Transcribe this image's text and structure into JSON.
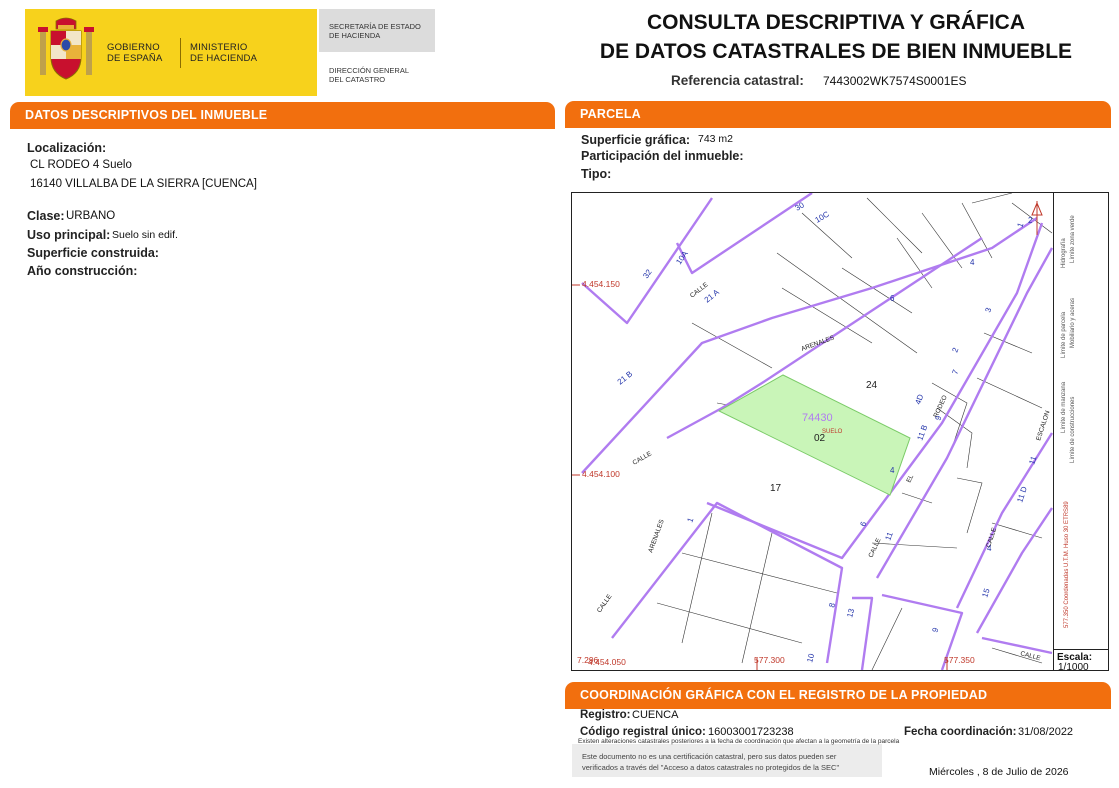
{
  "header": {
    "gobierno_line1": "GOBIERNO",
    "gobierno_line2": "DE ESPAÑA",
    "ministerio_line1": "MINISTERIO",
    "ministerio_line2": "DE HACIENDA",
    "secretaria_line1": "SECRETARÍA DE ESTADO",
    "secretaria_line2": "DE HACIENDA",
    "direccion_line1": "DIRECCIÓN GENERAL",
    "direccion_line2": "DEL CATASTRO",
    "title_line1": "CONSULTA DESCRIPTIVA Y GRÁFICA",
    "title_line2": "DE DATOS CATASTRALES DE BIEN INMUEBLE",
    "ref_label": "Referencia catastral:",
    "ref_value": "7443002WK7574S0001ES",
    "colors": {
      "yellow": "#f7d21c",
      "orange": "#f26f0e",
      "shield_red": "#c8102e"
    },
    "logo_icon": "coat-of-arms-icon"
  },
  "descriptivos": {
    "title": "DATOS DESCRIPTIVOS DEL INMUEBLE",
    "localizacion_label": "Localización:",
    "localizacion_line1": "CL RODEO 4 Suelo",
    "localizacion_line2": "16140 VILLALBA DE LA SIERRA [CUENCA]",
    "clase_label": "Clase:",
    "clase_value": "URBANO",
    "uso_label": "Uso principal:",
    "uso_value": "Suelo sin edif.",
    "superficie_label": "Superficie construida:",
    "anio_label": "Año construcción:"
  },
  "parcela": {
    "title": "PARCELA",
    "superficie_label": "Superficie gráfica:",
    "superficie_value": "743 m2",
    "participacion_label": "Participación del inmueble:",
    "tipo_label": "Tipo:"
  },
  "map": {
    "coord_y1": "4.454.150",
    "coord_y2": "4.454.100",
    "coord_y3": "4.454.050",
    "coord_x0": "7.296",
    "coord_x1": "577.300",
    "coord_x2": "577.350",
    "parcel_ref": "74430",
    "parcel_use": "SUELO",
    "parcel_num": "02",
    "num_24": "24",
    "num_17": "17",
    "street_calle": "CALLE",
    "street_arenales": "ARENALES",
    "street_rodeo": "RODEO",
    "street_el": "EL",
    "street_escalon": "ESCALON",
    "house_numbers": [
      "32",
      "30",
      "10C",
      "10A",
      "21 A",
      "21 B",
      "6",
      "4",
      "4D",
      "2",
      "3",
      "1",
      "9",
      "11 B",
      "7",
      "4",
      "6",
      "11",
      "1",
      "8",
      "13",
      "10",
      "15",
      "11 D",
      "4",
      "9",
      "11",
      "2"
    ],
    "legend": {
      "limite_manzana": "Límite de manzana",
      "limite_parcela": "Límite de parcela",
      "limite_construcciones": "Límite de construcciones",
      "mobiliario": "Mobiliario y aceras",
      "limite_zona_verde": "Límite zona verde",
      "hidrografia": "Hidrografía",
      "coordenadas": "577.350 Coordenadas U.T.M. Huso 30 ETRS89"
    },
    "north_icon": "north-arrow-icon",
    "escala_label": "Escala:",
    "escala_value": "1/1000",
    "colors": {
      "street": "#b07cf0",
      "parcel_fill": "#c9f5b8",
      "coord_red": "#c0392b",
      "number_blue": "#2233aa"
    }
  },
  "registro": {
    "title": "COORDINACIÓN GRÁFICA CON EL REGISTRO DE LA PROPIEDAD",
    "registro_label": "Registro:",
    "registro_value": "CUENCA",
    "codigo_label": "Código registral único:",
    "codigo_value": "16003001723238",
    "fecha_label": "Fecha coordinación:",
    "fecha_value": "31/08/2022",
    "note_small": "Existen alteraciones catastrales posteriores a la fecha de coordinación que afectan a la geometría de la parcela",
    "note_line1": "Este documento no es una certificación catastral, pero sus datos pueden ser",
    "note_line2": "verificados a través del \"Acceso a datos catastrales no protegidos de la SEC\""
  },
  "footer": {
    "date": "Miércoles , 8 de Julio de 2026"
  }
}
